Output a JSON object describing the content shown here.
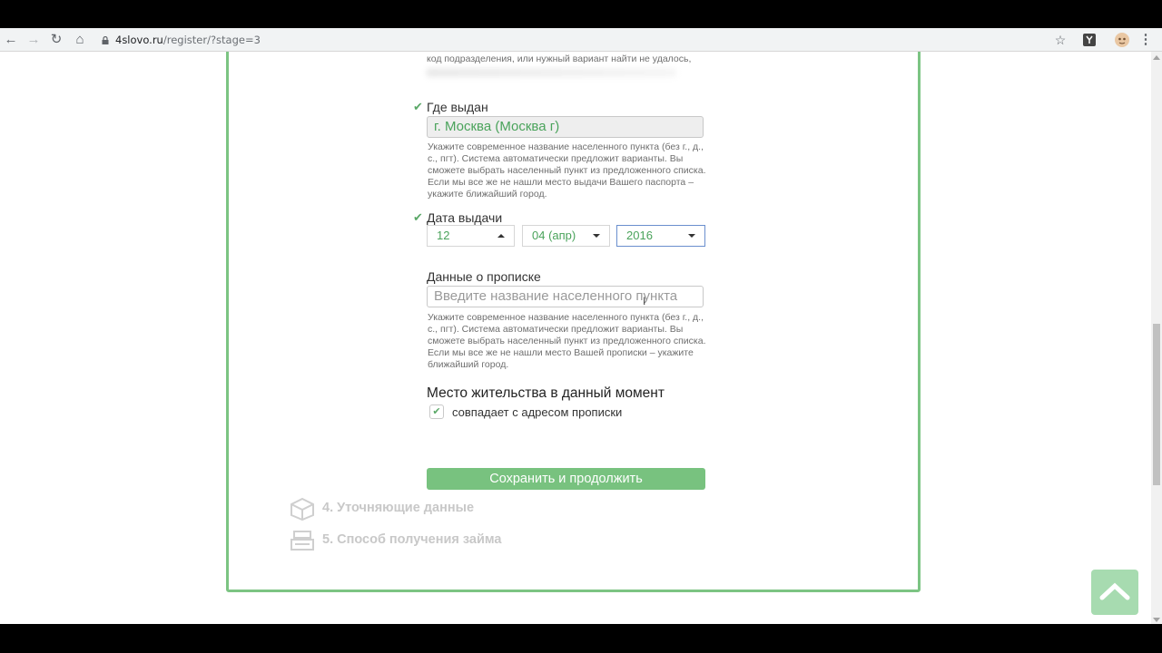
{
  "browser": {
    "url_domain": "4slovo.ru",
    "url_path": "/register/?stage=3"
  },
  "form": {
    "prev_hint_tail": "код подразделения, или нужный вариант найти не удалось,",
    "issued_where": {
      "label": "Где выдан",
      "value": "г. Москва (Москва г)",
      "hint": "Укажите современное название населенного пункта (без г., д., с., пгт). Система автоматически предложит варианты. Вы сможете выбрать населенный пункт из предложенного списка. Если мы все же не нашли место выдачи Вашего паспорта – укажите ближайший город."
    },
    "issue_date": {
      "label": "Дата выдачи",
      "day": "12",
      "month": "04 (апр)",
      "year": "2016"
    },
    "registration": {
      "label": "Данные о прописке",
      "placeholder": "Введите название населенного пункта",
      "hint": "Укажите современное название населенного пункта (без г., д., с., пгт). Система автоматически предложит варианты. Вы сможете выбрать населенный пункт из предложенного списка. Если мы все же не нашли место Вашей прописки – укажите ближайший город."
    },
    "residence": {
      "title": "Место жительства в данный момент",
      "checkbox_label": "совпадает с адресом прописки",
      "checked": true
    },
    "save_button": "Сохранить и продолжить"
  },
  "steps": [
    {
      "label": "4. Уточняющие данные",
      "icon": "box-icon"
    },
    {
      "label": "5. Способ получения займа",
      "icon": "cash-register-icon"
    }
  ],
  "colors": {
    "accent": "#78c27f",
    "border": "#7cc483",
    "value_text": "#4aa35b"
  }
}
